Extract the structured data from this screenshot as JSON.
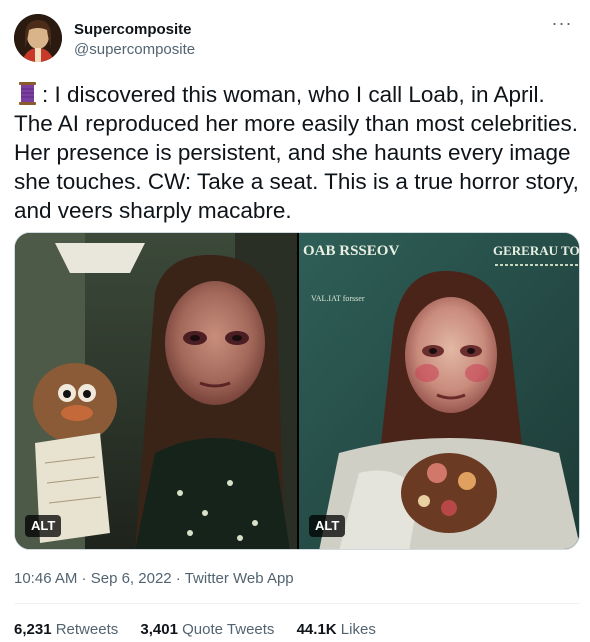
{
  "author": {
    "display_name": "Supercomposite",
    "handle": "@supercomposite",
    "avatar_icon": "portrait-avatar"
  },
  "more_icon": "ellipsis-icon",
  "more_label": "···",
  "tweet": {
    "thread_icon": "thread-spool-emoji",
    "text": ": I discovered this woman, who I call Loab, in April. The AI reproduced her more easily than most celebrities. Her presence is persistent, and she haunts every image she touches. CW: Take a seat. This is a true horror story, and veers sharply macabre."
  },
  "media": {
    "left_alt": "ALT",
    "right_alt": "ALT",
    "right_image_text": {
      "top_left": "OAB RSSEOV",
      "top_right": "GERERAU TO",
      "sub": "VAL.IAT forsser"
    }
  },
  "meta": {
    "time": "10:46 AM",
    "sep1": " · ",
    "date": "Sep 6, 2022",
    "sep2": " · ",
    "source": "Twitter Web App"
  },
  "stats": {
    "retweets_num": "6,231",
    "retweets_label": "Retweets",
    "quotes_num": "3,401",
    "quotes_label": "Quote Tweets",
    "likes_num": "44.1K",
    "likes_label": "Likes"
  },
  "colors": {
    "text_primary": "#0f1419",
    "text_secondary": "#536471",
    "divider": "#eff3f4",
    "thread_icon": "#7b3fa0"
  }
}
